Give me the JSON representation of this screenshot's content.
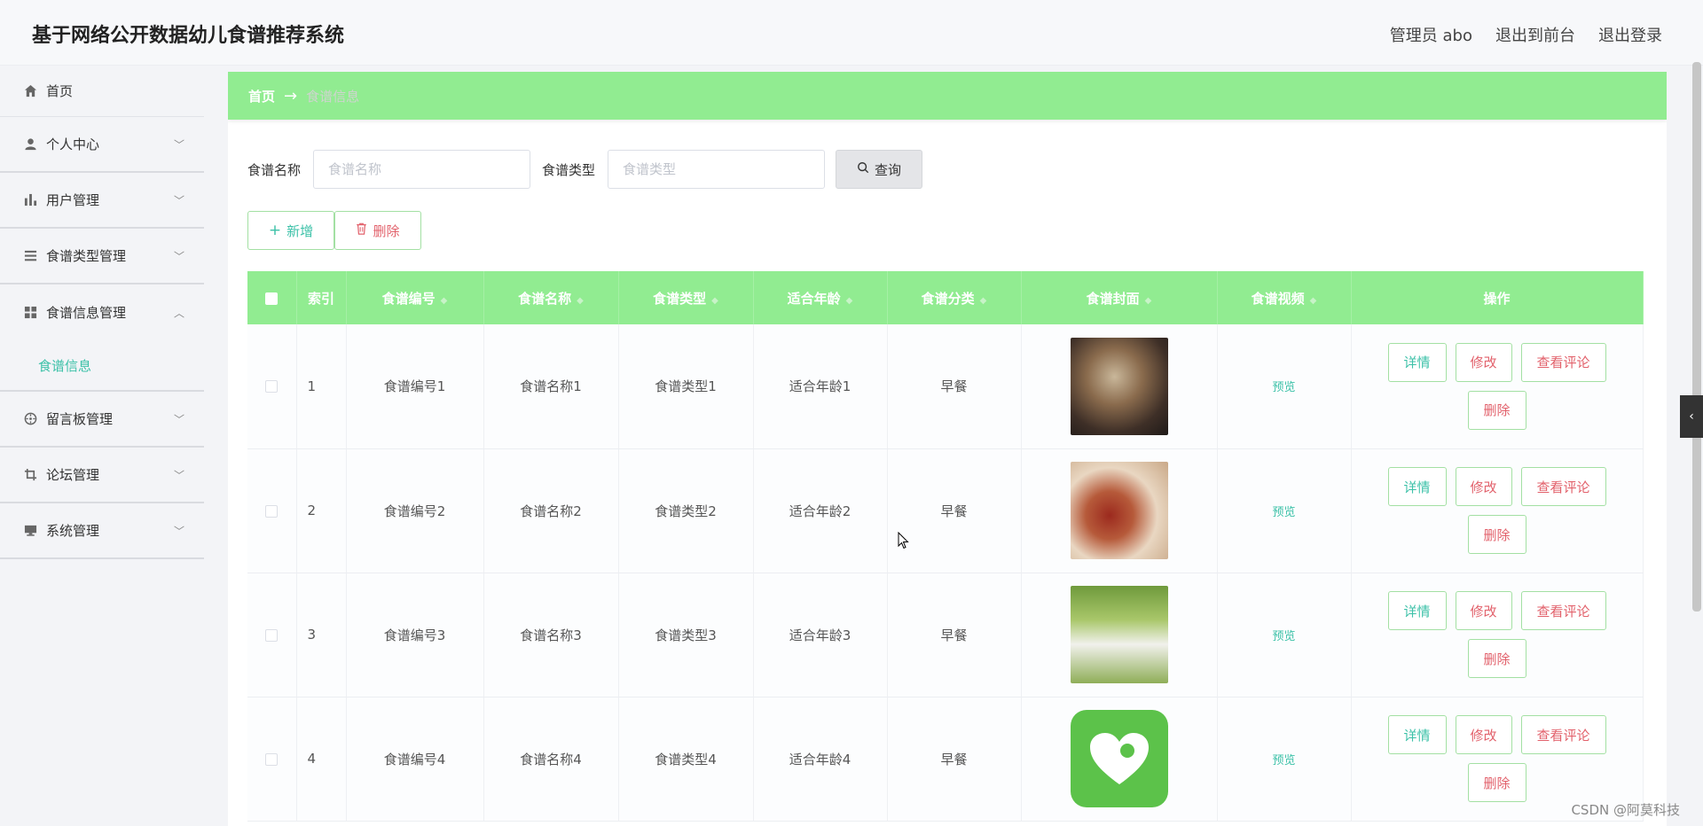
{
  "header": {
    "app_title": "基于网络公开数据幼儿食谱推荐系统",
    "admin_label": "管理员 abo",
    "to_front": "退出到前台",
    "logout": "退出登录"
  },
  "sidebar": {
    "items": [
      {
        "label": "首页",
        "icon": "home-icon"
      },
      {
        "label": "个人中心",
        "icon": "user-icon"
      },
      {
        "label": "用户管理",
        "icon": "bar-chart-icon"
      },
      {
        "label": "食谱类型管理",
        "icon": "list-icon"
      },
      {
        "label": "食谱信息管理",
        "icon": "grid-icon"
      },
      {
        "label": "留言板管理",
        "icon": "dial-icon"
      },
      {
        "label": "论坛管理",
        "icon": "crop-icon"
      },
      {
        "label": "系统管理",
        "icon": "monitor-icon"
      }
    ],
    "sub_item": "食谱信息"
  },
  "breadcrumb": {
    "home": "首页",
    "current": "食谱信息"
  },
  "search": {
    "name_label": "食谱名称",
    "name_placeholder": "食谱名称",
    "type_label": "食谱类型",
    "type_placeholder": "食谱类型",
    "query_label": "查询"
  },
  "actions": {
    "add": "新增",
    "delete": "删除"
  },
  "table": {
    "headers": [
      "索引",
      "食谱编号",
      "食谱名称",
      "食谱类型",
      "适合年龄",
      "食谱分类",
      "食谱封面",
      "食谱视频",
      "操作"
    ],
    "rows": [
      {
        "index": "1",
        "code": "食谱编号1",
        "name": "食谱名称1",
        "type": "食谱类型1",
        "age": "适合年龄1",
        "category": "早餐",
        "preview": "预览"
      },
      {
        "index": "2",
        "code": "食谱编号2",
        "name": "食谱名称2",
        "type": "食谱类型2",
        "age": "适合年龄2",
        "category": "早餐",
        "preview": "预览"
      },
      {
        "index": "3",
        "code": "食谱编号3",
        "name": "食谱名称3",
        "type": "食谱类型3",
        "age": "适合年龄3",
        "category": "早餐",
        "preview": "预览"
      },
      {
        "index": "4",
        "code": "食谱编号4",
        "name": "食谱名称4",
        "type": "食谱类型4",
        "age": "适合年龄4",
        "category": "早餐",
        "preview": "预览"
      }
    ],
    "ops": {
      "detail": "详情",
      "edit": "修改",
      "comments": "查看评论",
      "remove": "删除"
    }
  },
  "watermark": "CSDN @阿莫科技",
  "colors": {
    "accent_green": "#91ec91",
    "teal": "#3cc1a8",
    "danger": "#e2616b"
  }
}
